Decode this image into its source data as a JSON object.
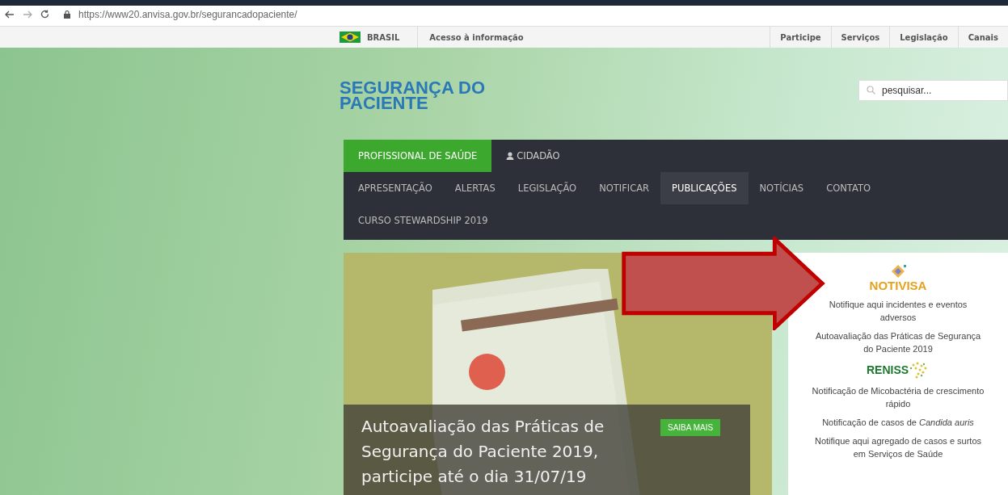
{
  "browser": {
    "url": "https://www20.anvisa.gov.br/segurancadopaciente/"
  },
  "gov_bar": {
    "country": "BRASIL",
    "left_links": [
      "Acesso à informação"
    ],
    "right_links": [
      "Participe",
      "Serviços",
      "Legislação",
      "Canais"
    ]
  },
  "site": {
    "title_lines": [
      "SEGURANÇA DO",
      "PACIENTE"
    ]
  },
  "search": {
    "placeholder": "pesquisar..."
  },
  "audience_tabs": [
    {
      "label": "PROFISSIONAL DE SAÚDE",
      "selected": true
    },
    {
      "label": "CIDADÃO",
      "selected": false
    }
  ],
  "menu": [
    {
      "label": "APRESENTAÇÃO",
      "selected": false
    },
    {
      "label": "ALERTAS",
      "selected": false
    },
    {
      "label": "LEGISLAÇÃO",
      "selected": false
    },
    {
      "label": "NOTIFICAR",
      "selected": false
    },
    {
      "label": "PUBLICAÇÕES",
      "selected": true
    },
    {
      "label": "NOTÍCIAS",
      "selected": false
    },
    {
      "label": "CONTATO",
      "selected": false
    },
    {
      "label": "CURSO STEWARDSHIP 2019",
      "selected": false
    }
  ],
  "banner": {
    "title": "Autoavaliação das Práticas de Segurança do Paciente 2019, participe até o dia 31/07/19",
    "button": "SAIBA MAIS"
  },
  "sidebar": [
    {
      "kind": "logo",
      "text": "NOTIVISA"
    },
    {
      "kind": "link",
      "text": "Notifique aqui incidentes e eventos adversos"
    },
    {
      "kind": "link",
      "text": "Autoavaliação das Práticas de Segurança do Paciente 2019"
    },
    {
      "kind": "logo2",
      "text": "RENISS"
    },
    {
      "kind": "link",
      "text": "Notificação de Micobactéria de crescimento rápido"
    },
    {
      "kind": "link",
      "text": "Notificação de casos de *Candida auris*"
    },
    {
      "kind": "link",
      "text": "Notifique aqui agregado de casos e surtos em Serviços de Saúde"
    }
  ]
}
